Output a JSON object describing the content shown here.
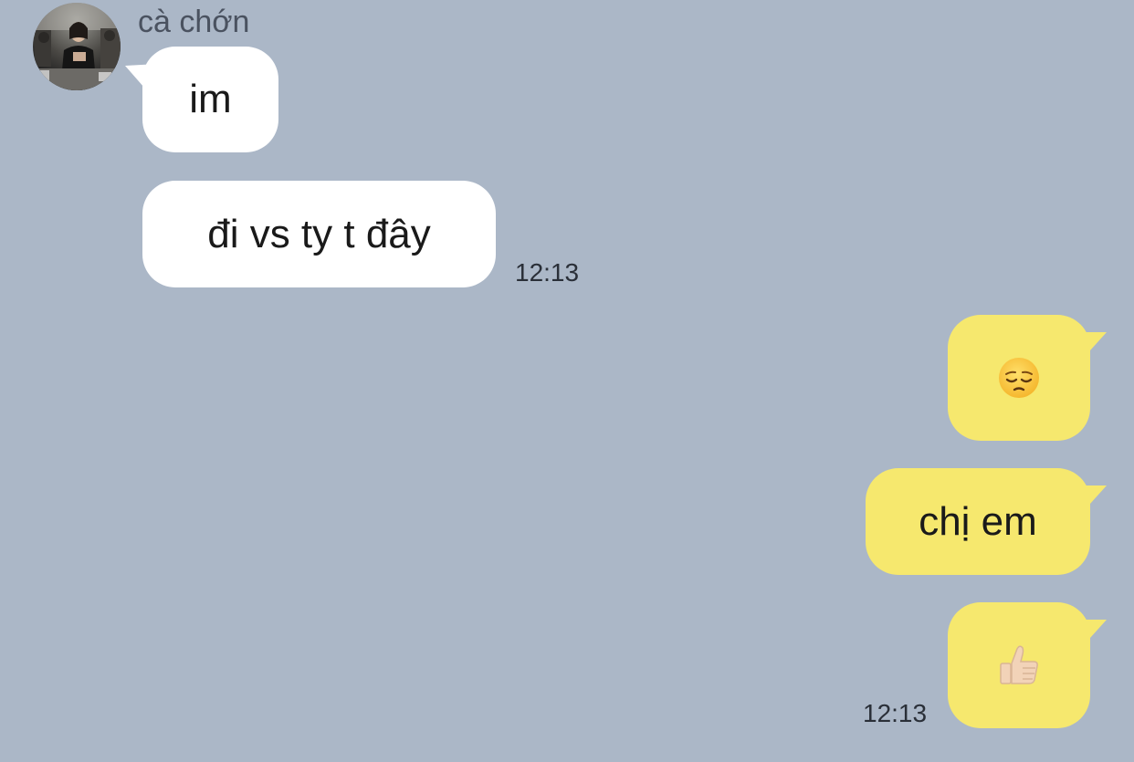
{
  "conversation": {
    "sender_name": "cà chớn",
    "incoming": [
      {
        "text": "im"
      },
      {
        "text": "đi vs ty t đây",
        "time": "12:13"
      }
    ],
    "outgoing": [
      {
        "emoji": "pensive-face-emoji"
      },
      {
        "text": "chị em"
      },
      {
        "emoji": "thumbs-up-emoji",
        "time": "12:13"
      }
    ]
  },
  "colors": {
    "background": "#abb7c7",
    "incoming_bubble": "#ffffff",
    "outgoing_bubble": "#f6e86e"
  }
}
